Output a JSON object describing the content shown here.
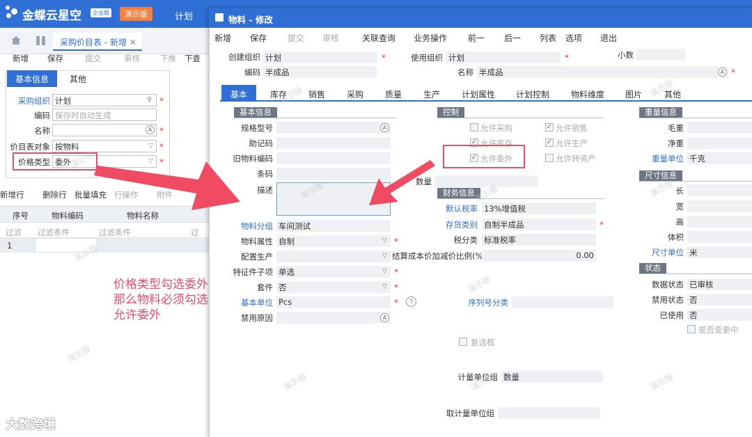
{
  "app": {
    "brand": "金蝶云星空",
    "edition_badge": "企业版",
    "demo_badge": "演示版",
    "top_menu": "计划"
  },
  "left_page": {
    "tab_title": "采购价目表 - 新增",
    "toolbar": [
      "新增",
      "保存",
      "提交",
      "审核",
      "下推",
      "下查"
    ],
    "panel_tabs": [
      "基本信息",
      "其他"
    ],
    "fields": [
      {
        "label": "采购组织",
        "value": "计划",
        "required": true
      },
      {
        "label": "编码",
        "value": "",
        "placeholder": "保存时自动生成"
      },
      {
        "label": "名称",
        "value": "",
        "required": true
      },
      {
        "label": "价目表对象",
        "value": "按物料",
        "required": true
      },
      {
        "label": "价格类型",
        "value": "委外",
        "required": true
      }
    ],
    "grid_toolbar": [
      "新增行",
      "删除行",
      "批量填充",
      "行操作",
      "附件"
    ],
    "grid_columns": [
      "序号",
      "物料编码",
      "物料名称"
    ],
    "filter_placeholders": [
      "过滤",
      "过滤条件",
      "过滤条件",
      "过"
    ],
    "row_number": "1"
  },
  "annotation": {
    "lines": [
      "价格类型勾选委外",
      "那么物料必须勾选",
      "允许委外"
    ]
  },
  "watermark_brand": "大数跨境",
  "watermark_text": "演示版",
  "dialog": {
    "title": "物料 - 修改",
    "toolbar": [
      "新增",
      "保存",
      "提交",
      "审核",
      "关联查询",
      "业务操作",
      "前一",
      "后一",
      "列表",
      "选项",
      "退出"
    ],
    "header": {
      "create_org_label": "创建组织",
      "create_org_value": "计划",
      "use_org_label": "使用组织",
      "use_org_value": "计划",
      "small_label": "小数",
      "code_label": "编码",
      "code_value": "半成品",
      "name_label": "名称",
      "name_value": "半成品"
    },
    "tabs": [
      "基本",
      "库存",
      "销售",
      "采购",
      "质量",
      "生产",
      "计划属性",
      "计划控制",
      "物料维度",
      "图片",
      "其他"
    ],
    "basic": {
      "section": "基本信息",
      "spec_label": "规格型号",
      "mnemonic_label": "助记码",
      "old_code_label": "旧物料编码",
      "barcode_label": "条码",
      "desc_label": "描述",
      "group_label": "物料分组",
      "group_value": "车间测试",
      "attr_label": "物料属性",
      "attr_value": "自制",
      "config_label": "配置生产",
      "feature_label": "特征件子项",
      "feature_value": "单选",
      "kit_label": "套件",
      "kit_value": "否",
      "unit_label": "基本单位",
      "unit_value": "Pcs",
      "disable_reason_label": "禁用原因"
    },
    "control": {
      "section": "控制",
      "checks": [
        {
          "label": "允许采购",
          "checked": false
        },
        {
          "label": "允许销售",
          "checked": true
        },
        {
          "label": "允许库存",
          "checked": true
        },
        {
          "label": "允许生产",
          "checked": true
        },
        {
          "label": "允许委外",
          "checked": true
        },
        {
          "label": "允许转资产",
          "checked": false
        }
      ],
      "qty_label": "数量"
    },
    "finance": {
      "section": "财务信息",
      "tax_label": "默认税率",
      "tax_value": "13%增值税",
      "stock_cat_label": "存货类别",
      "stock_cat_value": "自制半成品",
      "tax_class_label": "税分类",
      "tax_class_value": "标准税率",
      "cost_ratio_label": "结算成本价加减价比例(%)",
      "cost_ratio_value": "0.00",
      "serial_label": "序列号分类",
      "check_label": "复选框",
      "unit_group_label": "计量单位组",
      "unit_group_value": "数量",
      "aux_unit_group_label": "取计量单位组"
    },
    "weight": {
      "section": "重量信息",
      "gross_label": "毛重",
      "net_label": "净重",
      "unit_label": "重量单位",
      "unit_value": "千克"
    },
    "size": {
      "section": "尺寸信息",
      "length_label": "长",
      "width_label": "宽",
      "height_label": "高",
      "volume_label": "体积",
      "unit_label": "尺寸单位",
      "unit_value": "米"
    },
    "status": {
      "section": "状态",
      "data_status_label": "数据状态",
      "data_status_value": "已审核",
      "forbid_label": "禁用状态",
      "forbid_value": "否",
      "used_label": "已使用",
      "used_value": "否",
      "changed_label": "是否变更中"
    }
  },
  "colors": {
    "primary": "#2f6fd6",
    "highlight": "#ee4a6a",
    "demo_badge": "#f4803b"
  }
}
